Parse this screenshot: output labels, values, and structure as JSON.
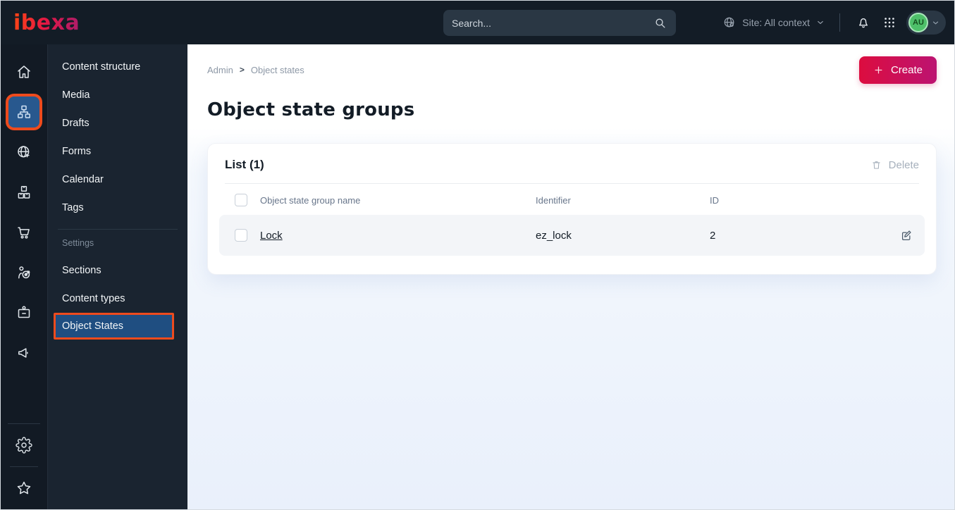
{
  "topbar": {
    "logo": "ibexa",
    "search_placeholder": "Search...",
    "site_context": "Site: All context",
    "avatar_initials": "AU"
  },
  "iconbar": {
    "icons": [
      "home",
      "content-structure",
      "site",
      "product-catalog",
      "commerce",
      "personalization",
      "customers",
      "campaigns",
      "settings",
      "bookmarks"
    ],
    "active_icon": "content-structure"
  },
  "sidebar": {
    "items": [
      "Content structure",
      "Media",
      "Drafts",
      "Forms",
      "Calendar",
      "Tags"
    ],
    "section_label": "Settings",
    "settings_items": [
      "Sections",
      "Content types",
      "Object States"
    ],
    "active_item": "Object States"
  },
  "main": {
    "breadcrumb": [
      "Admin",
      "Object states"
    ],
    "breadcrumb_separator": ">",
    "title": "Object state groups",
    "create_label": "Create",
    "card": {
      "title": "List (1)",
      "delete_label": "Delete",
      "columns": [
        "Object state group name",
        "Identifier",
        "ID"
      ],
      "rows": [
        {
          "name": "Lock",
          "identifier": "ez_lock",
          "id": "2"
        }
      ]
    }
  },
  "colors": {
    "topbar_bg": "#131c26",
    "sidebar_bg": "#1a2430",
    "active_blue": "#1f4e81",
    "annotation_orange": "#ee4b1d",
    "accent_red": "#dc0d3f",
    "accent_magenta": "#bc1371",
    "avatar_green": "#4ec06a"
  }
}
